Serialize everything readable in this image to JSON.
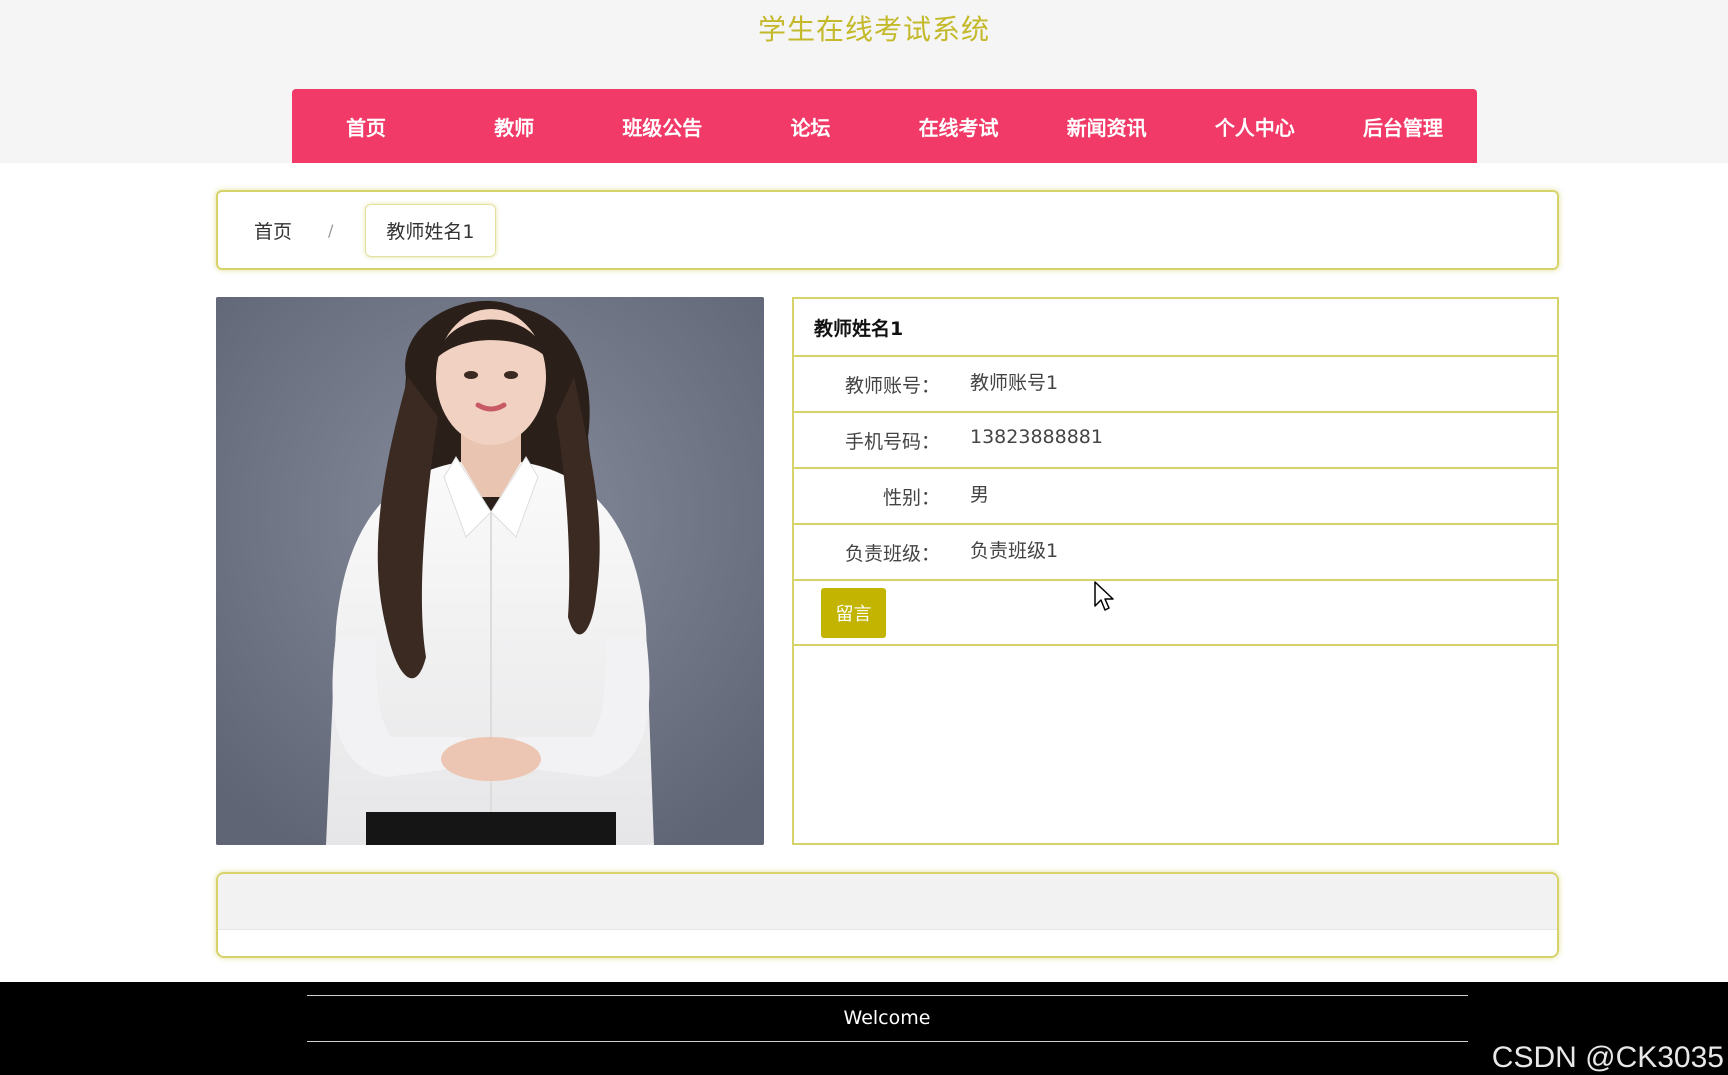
{
  "site": {
    "title": "学生在线考试系统"
  },
  "nav": {
    "items": [
      "首页",
      "教师",
      "班级公告",
      "论坛",
      "在线考试",
      "新闻资讯",
      "个人中心",
      "后台管理"
    ]
  },
  "breadcrumb": {
    "home": "首页",
    "separator": "/",
    "current": "教师姓名1"
  },
  "teacher": {
    "name": "教师姓名1",
    "fields": [
      {
        "label": "教师账号：",
        "value": "教师账号1"
      },
      {
        "label": "手机号码：",
        "value": "13823888881"
      },
      {
        "label": "性别：",
        "value": "男"
      },
      {
        "label": "负责班级：",
        "value": "负责班级1"
      }
    ],
    "message_button": "留言"
  },
  "footer": {
    "welcome": "Welcome"
  },
  "watermark": "CSDN @CK3035",
  "colors": {
    "accent": "#f23a68",
    "title": "#c4b92a",
    "border": "#d6d36a",
    "button": "#c2b400"
  }
}
